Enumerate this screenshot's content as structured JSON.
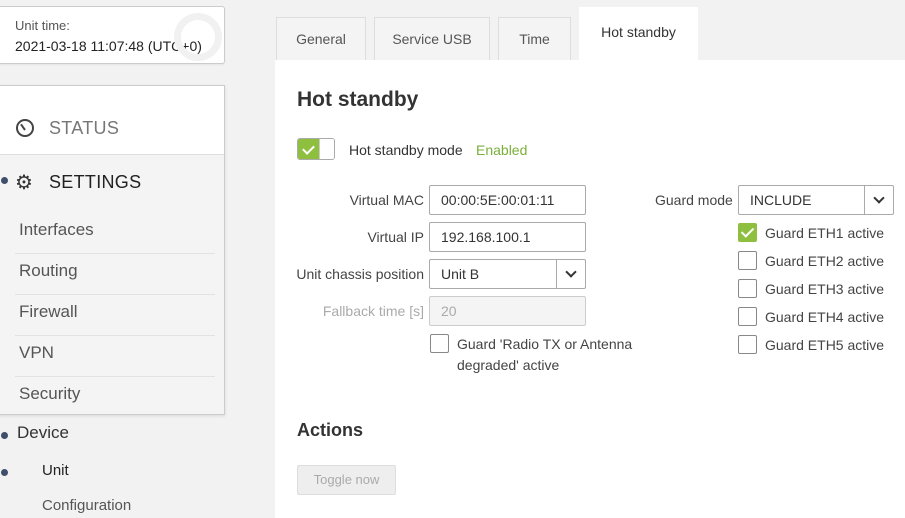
{
  "unit_time": {
    "label": "Unit time:",
    "value": "2021-03-18 11:07:48 (UTC+0)"
  },
  "menu": {
    "status": "STATUS",
    "settings": "SETTINGS",
    "items": [
      "Interfaces",
      "Routing",
      "Firewall",
      "VPN",
      "Security"
    ],
    "device": "Device",
    "unit": "Unit",
    "configuration": "Configuration"
  },
  "tabs": [
    "General",
    "Service USB",
    "Time",
    "Hot standby"
  ],
  "panel": {
    "title": "Hot standby",
    "mode_label": "Hot standby mode",
    "mode_state": "Enabled",
    "virtual_mac_label": "Virtual MAC",
    "virtual_mac": "00:00:5E:00:01:11",
    "virtual_ip_label": "Virtual IP",
    "virtual_ip": "192.168.100.1",
    "chassis_label": "Unit chassis position",
    "chassis": "Unit B",
    "fallback_label": "Fallback time [s]",
    "fallback": "20",
    "guard_radio_line1": "Guard 'Radio TX or Antenna",
    "guard_radio_line2": "degraded' active",
    "guard_mode_label": "Guard mode",
    "guard_mode": "INCLUDE",
    "guards": [
      {
        "label": "Guard ETH1 active",
        "checked": true
      },
      {
        "label": "Guard ETH2 active",
        "checked": false
      },
      {
        "label": "Guard ETH3 active",
        "checked": false
      },
      {
        "label": "Guard ETH4 active",
        "checked": false
      },
      {
        "label": "Guard ETH5 active",
        "checked": false
      }
    ],
    "actions_title": "Actions",
    "toggle_now": "Toggle now"
  },
  "colors": {
    "accent_green": "#8fbf3f",
    "enabled_text": "#7ab03a",
    "nav_dot": "#3d4f6b"
  }
}
